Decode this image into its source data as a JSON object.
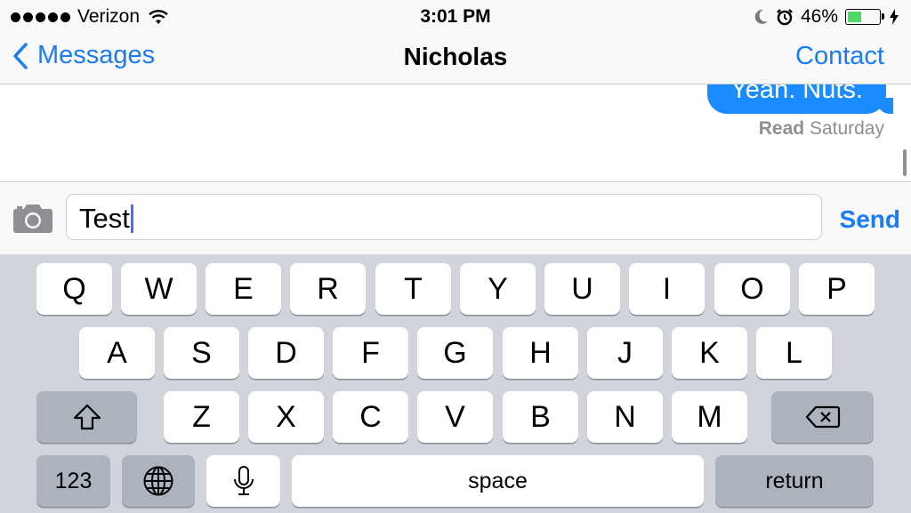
{
  "status_bar": {
    "carrier": "Verizon",
    "time": "3:01 PM",
    "battery_percent_label": "46%",
    "battery_level": 0.46,
    "icons": [
      "signal-dots-icon",
      "wifi-icon",
      "moon-icon",
      "alarm-icon",
      "battery-icon",
      "charging-bolt-icon"
    ]
  },
  "nav": {
    "back_label": "Messages",
    "title": "Nicholas",
    "right_label": "Contact"
  },
  "conversation": {
    "last_message": "Yeah. Nuts.",
    "read_label": "Read",
    "read_time": "Saturday"
  },
  "composer": {
    "text": "Test",
    "send_label": "Send",
    "camera_icon": "camera-icon"
  },
  "keyboard": {
    "row1": [
      "Q",
      "W",
      "E",
      "R",
      "T",
      "Y",
      "U",
      "I",
      "O",
      "P"
    ],
    "row2": [
      "A",
      "S",
      "D",
      "F",
      "G",
      "H",
      "J",
      "K",
      "L"
    ],
    "row3": [
      "Z",
      "X",
      "C",
      "V",
      "B",
      "N",
      "M"
    ],
    "numbers_label": "123",
    "space_label": "space",
    "return_label": "return",
    "icons": [
      "shift-icon",
      "delete-icon",
      "globe-icon",
      "microphone-icon"
    ]
  },
  "colors": {
    "accent": "#1a7cf5",
    "bubble": "#1a8cff",
    "battery_fill": "#4cd964",
    "keyboard_bg": "#d1d5db"
  }
}
